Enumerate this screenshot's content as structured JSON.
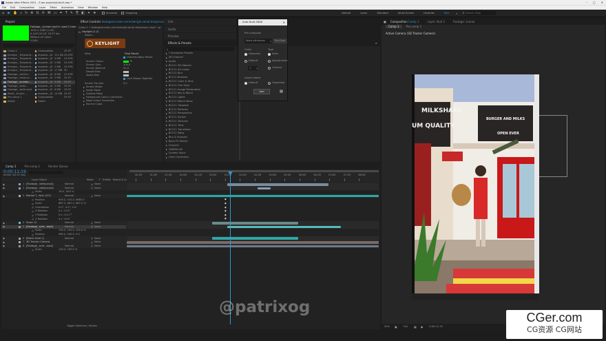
{
  "window": {
    "title": "Adobe After Effects 2021 - E:\\ae projects\\tuts24.aep *"
  },
  "menu": [
    "File",
    "Edit",
    "Composition",
    "Layer",
    "Effect",
    "Animation",
    "View",
    "Window",
    "Help"
  ],
  "toolbar": {
    "universal": "Universal",
    "snapping": "Snapping",
    "workspaces": [
      "Default",
      "Learn",
      "Standard",
      "Small Screen",
      "Libraries",
      "Text"
    ],
    "more": "»",
    "search_placeholder": "Search Help"
  },
  "project_panel": {
    "tab": "Project",
    "selected_name": "Footage_ scream.mp4 ▾, used 1 time",
    "info_lines": [
      "1920 x 1080 (1.00)",
      "Δ 0;00;19;23, 29.97 fps",
      "Millions of Colors",
      "H.264"
    ],
    "items": [
      {
        "name": "Comp 1",
        "type": "Composition",
        "size": "",
        "rate": "29.97",
        "color": "#c8a86a"
      },
      {
        "name": "Energia _ Emprend...",
        "type": "Importe...JG",
        "size": "111 KB",
        "rate": "23.976",
        "color": "#8a9bb8"
      },
      {
        "name": "Energia _ Emprend...",
        "type": "Importe...JG",
        "size": "3 MB",
        "rate": "23.976",
        "color": "#8a9bb8"
      },
      {
        "name": "Energia _ Emprend...",
        "type": "Importe...JG",
        "size": "2 MB",
        "rate": "23.976",
        "color": "#8a9bb8"
      },
      {
        "name": "Energia _ Emprend...",
        "type": "Importe...JG",
        "size": "2 MB",
        "rate": "23.976",
        "color": "#8a9bb8"
      },
      {
        "name": "Energia _ Emprend...",
        "type": "Importe...JG",
        "size": "17 MB",
        "rate": "30",
        "color": "#8a9bb8"
      },
      {
        "name": "Footage_ drinkin...",
        "type": "Importe...JG",
        "size": "6 MB",
        "rate": "23.976",
        "color": "#8a9bb8"
      },
      {
        "name": "Footage_ hardcut...",
        "type": "Importe...JG",
        "size": "2 MB",
        "rate": "29.97",
        "color": "#8a9bb8"
      },
      {
        "name": "Footage_ scream...",
        "type": "Importe...JG",
        "size": "9 MB",
        "rate": "29.97",
        "color": "#8a9bb8",
        "selected": true
      },
      {
        "name": "Footage_ strea...",
        "type": "Importe...JG",
        "size": "5 MB",
        "rate": "29.97",
        "color": "#8a9bb8"
      },
      {
        "name": "Footage_ wide.mp4",
        "type": "Importe...JG",
        "size": "6 MB",
        "rate": "29.97",
        "color": "#8a9bb8"
      },
      {
        "name": "Pexel_ Acrylic...",
        "type": "Importe...JG",
        "size": "14 MB",
        "rate": "29.97",
        "color": "#8a9bb8"
      },
      {
        "name": "Pre-comp 1",
        "type": "Composition",
        "size": "",
        "rate": "29.97",
        "color": "#c8a86a"
      },
      {
        "name": "Solids",
        "type": "Folder",
        "size": "",
        "rate": "",
        "color": "#d8b84a"
      }
    ]
  },
  "effect_controls": {
    "tab": "Effect Controls",
    "tab_target": "footage/scream-vermi/wrigle-serial-dreparsocn.mp4",
    "header": "Comp 1 • footage/scream.vermi/wrigle-serial-dreparsocn.mp4 • greenscreen.mp4",
    "effect_name": "Keylight (1.2)",
    "about": "About...",
    "logo_text": "KEYLIGHT",
    "view_label": "View",
    "view_value": "Final Result",
    "unpremultiply": "Unpremultiply Result",
    "screen_colour": "Screen Colour",
    "screen_gain": "Screen Gain",
    "screen_gain_val": "100.0",
    "screen_balance": "Screen Balance",
    "screen_balance_val": "50.0",
    "despill_bias": "Despill Bias",
    "alpha_bias": "Alpha Bias",
    "lock_biases": "Lock Biases Together",
    "screen_preblur": "Screen Pre-blur",
    "screen_preblur_val": "0.0",
    "sections": [
      "Screen Matte",
      "Inside Mask",
      "Outside Mask",
      "Foreground Colour Correction",
      "Edge Colour Correction",
      "Source Crops"
    ]
  },
  "info_panel": {
    "tab": "Info",
    "audio_tab": "Audio",
    "preview_tab": "Preview"
  },
  "effects_presets": {
    "tab": "Effects & Presets",
    "search_placeholder": "",
    "items": [
      "* Animation Presets",
      "3D Channel",
      "Audio",
      "BCC11 3D Objects",
      "BCC11 Art Looks",
      "BCC11 Blur",
      "BCC11 Browser",
      "BCC11 Color & Tone",
      "BCC11 Film Style",
      "BCC11 Image Restoration",
      "BCC11 Key & Blend",
      "BCC11 Lights",
      "BCC11 Match Move",
      "BCC11 Obsolete",
      "BCC11 Particles",
      "BCC11 Perspective",
      "BCC11 Stylize",
      "BCC11 Textures",
      "BCC11 Time",
      "BCC11 Transitions",
      "BCC11 Warp",
      "Blur & Sharpen",
      "Boris FX Mocha",
      "Channel",
      "CINEMA 4D",
      "Cinema Spice",
      "Color Correction"
    ]
  },
  "auto_dialog": {
    "title": "Auto-Nulls 2BAK",
    "pre_compose": "Pre-Compose",
    "field_value": "Word attributes",
    "button_right": "Pre-Com",
    "order_label": "Order",
    "type_label": "Type",
    "opts_left": [
      "Hierarchy",
      "Default"
    ],
    "opts_right": [
      "Nulls",
      "Adjustments",
      "Camera"
    ],
    "stepper_val": "1",
    "layers_label": "Layers Name",
    "layers_opts": [
      "Default",
      "Organized"
    ],
    "add_button": "Add",
    "info_icon": "i"
  },
  "composition_viewer": {
    "tab": "Composition",
    "tab_target": "Comp 1",
    "layer_tab": "Layer: Null 3",
    "footage_tab": "Footage: (none)",
    "subtabs": [
      "Comp 1",
      "Pre-comp 1"
    ],
    "camera_label": "Active Camera (3D Tracker Camera)",
    "zoom": "50%",
    "resolution": "Full",
    "timecode": "0:00:11:19",
    "sign_milkshake": "MILKSHAKE",
    "sign_quality": "UM QUALITY",
    "sign_burger": "BURGER AND MILKS",
    "sign_open": "OPEN EVER"
  },
  "timeline": {
    "tabs": [
      "Comp 1",
      "Pre-comp 1",
      "Render Queue"
    ],
    "timecode": "0:00:11:19",
    "timecode_sub": "00349 (29.97 fps)",
    "columns": [
      "Layer Name",
      "Mode",
      "T",
      "TrkMat",
      "Parent & Link"
    ],
    "ruler": [
      "00:15f",
      "01:00f",
      "01:15f",
      "02:00f",
      "02:15f",
      "03:00f",
      "03:15f",
      "04:00f",
      "04:15f",
      "05:00f",
      "05:15f",
      "06:00f",
      "06:15f",
      "07:00f",
      "07:15f",
      "08:00f"
    ],
    "layers": [
      {
        "num": "1",
        "name": "[Footage_ valley.mp4]",
        "mode": "Normal",
        "parent": "None",
        "color": "#8a9bb8"
      },
      {
        "num": "2",
        "name": "[Footage_ valley.mp4]",
        "mode": "Normal",
        "parent": "None",
        "color": "#8a9bb8"
      },
      {
        "num": "",
        "name": "Scale",
        "value": "16.0, 16.0 %",
        "prop": true
      },
      {
        "num": "3",
        "name": "Mental T...Null (137)",
        "mode": "Normal",
        "parent": "None",
        "color": "#c9a0a0"
      },
      {
        "num": "",
        "name": "Position",
        "value": "959.0, 415.0, 6685.0",
        "prop": true
      },
      {
        "num": "",
        "name": "Scale",
        "value": "687.5, 687.5, 687.5 %",
        "prop": true
      },
      {
        "num": "",
        "name": "Orientation",
        "value": "0.0°, 0.0°, 0.0°",
        "prop": true
      },
      {
        "num": "",
        "name": "X Rotation",
        "value": "0 x +0.0°",
        "prop": true
      },
      {
        "num": "",
        "name": "Y Rotation",
        "value": "0 x +12.7°",
        "prop": true
      },
      {
        "num": "",
        "name": "Z Rotation",
        "value": "0 x +0.0°",
        "prop": true
      },
      {
        "num": "4",
        "name": "Scale 12",
        "mode": "Normal",
        "parent": "None",
        "color": "#6ab8c8"
      },
      {
        "num": "5",
        "name": "[Footage_ scre...mp4]",
        "mode": "Normal",
        "parent": "None",
        "color": "#8a9bb8",
        "selected": true
      },
      {
        "num": "",
        "name": "Scale",
        "value": "100.0, 100.0, 100.0 %",
        "prop": true
      },
      {
        "num": "",
        "name": "Position",
        "value": "960.0, 540.0, 0.0",
        "prop": true
      },
      {
        "num": "6",
        "name": "[Black Solid 1]",
        "mode": "Normal",
        "parent": "None",
        "color": "#a0a0a0"
      },
      {
        "num": "7",
        "name": "3D Tracker Camera",
        "mode": "",
        "parent": "None",
        "color": "#c9a0a0"
      },
      {
        "num": "8",
        "name": "[Footage_ scre...mp4]",
        "mode": "Normal",
        "parent": "None",
        "color": "#8a9bb8"
      },
      {
        "num": "",
        "name": "Scale",
        "value": "100.0, 100.0 %",
        "prop": true
      }
    ],
    "footer": "Toggle Switches / Modes"
  },
  "watermark": "@patrixog",
  "brand": {
    "main": "CGer.com",
    "sub": "CG资源 CG网站"
  },
  "colors": {
    "accent": "#2f9bd8",
    "bg": "#1d1d1d",
    "panel": "#232323",
    "green_screen": "#00ff00",
    "teal": "#2ea8a8"
  }
}
